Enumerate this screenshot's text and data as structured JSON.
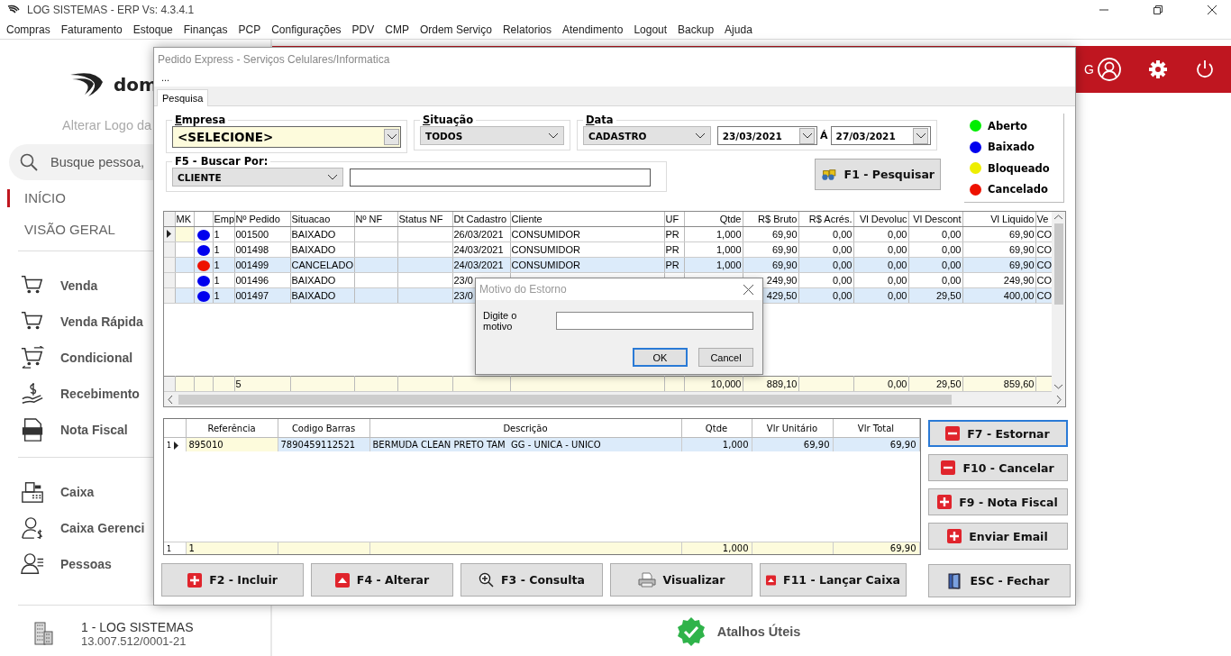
{
  "app": {
    "title": "LOG SISTEMAS - ERP Vs: 4.3.4.1",
    "menu": [
      "Compras",
      "Faturamento",
      "Estoque",
      "Finanças",
      "PCP",
      "Configurações",
      "PDV",
      "CMP",
      "Ordem Serviço",
      "Relatorios",
      "Atendimento",
      "Logout",
      "Backup",
      "Ajuda"
    ]
  },
  "sidebar": {
    "logo_text": "dom",
    "logo_caption": "Alterar Logo da",
    "search": {
      "placeholder": "Busque pessoa,"
    },
    "nav": [
      {
        "label": "INÍCIO",
        "selected": true
      },
      {
        "label": "VISÃO GERAL",
        "selected": false
      }
    ],
    "groups": [
      [
        {
          "label": "Venda"
        },
        {
          "label": "Venda Rápida"
        },
        {
          "label": "Condicional"
        },
        {
          "label": "Recebimento"
        },
        {
          "label": "Nota Fiscal"
        }
      ],
      [
        {
          "label": "Caixa"
        },
        {
          "label": "Caixa Gerenci"
        },
        {
          "label": "Pessoas"
        }
      ]
    ],
    "company": {
      "name": "1 - LOG SISTEMAS",
      "cnpj": "13.007.512/0001-21"
    }
  },
  "header": {
    "user_text": "G"
  },
  "shortcuts": {
    "label": "Atalhos Úteis"
  },
  "order_window": {
    "title": "Pedido Express - Serviços Celulares/Informatica",
    "menu": "...",
    "tabs": [
      {
        "label": "Pesquisa",
        "selected": true
      }
    ],
    "filters": {
      "empresa": {
        "label": "Empresa",
        "underline_first": true,
        "value": "<SELECIONE>"
      },
      "situacao": {
        "label": "Situação",
        "underline_first": true,
        "value": "TODOS"
      },
      "data": {
        "label": "Data",
        "underline_first": true,
        "value": "CADASTRO",
        "from": "23/03/2021",
        "separator": "Á",
        "to": "27/03/2021"
      },
      "buscar": {
        "label": "F5 - Buscar Por:",
        "underline_first": false,
        "value": "CLIENTE"
      }
    },
    "search_button": "F1 - Pesquisar",
    "legend": [
      {
        "label": "Aberto",
        "color": "#00ee00"
      },
      {
        "label": "Baixado",
        "color": "#0000ee"
      },
      {
        "label": "Bloqueado",
        "color": "#eeee00"
      },
      {
        "label": "Cancelado",
        "color": "#ee1100"
      }
    ],
    "orders": {
      "columns": [
        {
          "label": "MK",
          "kind": "text"
        },
        {
          "kind": "status"
        },
        {
          "label": "Emp",
          "kind": "text"
        },
        {
          "label": "Nº Pedido",
          "kind": "text"
        },
        {
          "label": "Situacao",
          "kind": "text"
        },
        {
          "label": "Nº NF",
          "kind": "text"
        },
        {
          "label": "Status NF",
          "kind": "text"
        },
        {
          "label": "Dt Cadastro",
          "kind": "text"
        },
        {
          "label": "Cliente",
          "kind": "text"
        },
        {
          "label": "UF",
          "kind": "text"
        },
        {
          "label": "Qtde",
          "kind": "number"
        },
        {
          "label": "R$ Bruto",
          "kind": "number"
        },
        {
          "label": "R$ Acrés.",
          "kind": "number"
        },
        {
          "label": "Vl Devoluc",
          "kind": "number"
        },
        {
          "label": "Vl Descont",
          "kind": "number"
        },
        {
          "label": "Vl Liquido",
          "kind": "number"
        },
        {
          "label": "Ve",
          "kind": "text"
        }
      ],
      "rows": [
        {
          "current": true,
          "selected": false,
          "color": "#0000ee",
          "emp": "1",
          "pedido": "001500",
          "situacao": "BAIXADO",
          "dt_cadastro": "26/03/2021",
          "cliente": "CONSUMIDOR",
          "uf": "PR",
          "qtde": "1,000",
          "bruto": "69,90",
          "acres": "0,00",
          "devoluc": "0,00",
          "descont": "0,00",
          "liquido": "69,90",
          "ve": "CO"
        },
        {
          "current": false,
          "selected": false,
          "color": "#0000ee",
          "emp": "1",
          "pedido": "001498",
          "situacao": "BAIXADO",
          "dt_cadastro": "24/03/2021",
          "cliente": "CONSUMIDOR",
          "uf": "PR",
          "qtde": "1,000",
          "bruto": "69,90",
          "acres": "0,00",
          "devoluc": "0,00",
          "descont": "0,00",
          "liquido": "69,90",
          "ve": "CO"
        },
        {
          "current": false,
          "selected": true,
          "color": "#ee1100",
          "emp": "1",
          "pedido": "001499",
          "situacao": "CANCELADO",
          "dt_cadastro": "24/03/2021",
          "cliente": "CONSUMIDOR",
          "uf": "PR",
          "qtde": "1,000",
          "bruto": "69,90",
          "acres": "0,00",
          "devoluc": "0,00",
          "descont": "0,00",
          "liquido": "69,90",
          "ve": "CO"
        },
        {
          "current": false,
          "selected": false,
          "color": "#0000ee",
          "emp": "1",
          "pedido": "001496",
          "situacao": "BAIXADO",
          "dt_cadastro": "23/0",
          "bruto": "249,90",
          "acres": "0,00",
          "devoluc": "0,00",
          "descont": "0,00",
          "liquido": "249,90",
          "ve": "CO"
        },
        {
          "current": false,
          "selected": true,
          "color": "#0000ee",
          "emp": "1",
          "pedido": "001497",
          "situacao": "BAIXADO",
          "dt_cadastro": "23/0",
          "bruto": "429,50",
          "acres": "0,00",
          "devoluc": "0,00",
          "descont": "29,50",
          "liquido": "400,00",
          "ve": "CO"
        }
      ],
      "totals": {
        "pedido": "5",
        "qtde": "10,000",
        "bruto": "889,10",
        "devoluc": "0,00",
        "descont": "29,50",
        "liquido": "859,60"
      }
    },
    "items": {
      "columns": [
        {
          "label": "Referência",
          "kind": "text"
        },
        {
          "label": "Codigo Barras",
          "kind": "text"
        },
        {
          "label": "Descrição",
          "kind": "text"
        },
        {
          "label": "Qtde",
          "kind": "number"
        },
        {
          "label": "Vlr Unitário",
          "kind": "number"
        },
        {
          "label": "Vlr Total",
          "kind": "number"
        }
      ],
      "rows": [
        {
          "index": "1",
          "current": true,
          "cells": [
            "895010",
            "7890459112521",
            "BERMUDA CLEAN PRETO TAM  GG - UNICA - UNICO",
            "1,000",
            "69,90",
            "69,90"
          ]
        }
      ],
      "totals": {
        "index": "1",
        "referencia": "1",
        "qtde": "1,000",
        "vlr_total": "69,90"
      }
    },
    "side_buttons": [
      {
        "label": "F7 - Estornar",
        "focused": true
      },
      {
        "label": "F10 - Cancelar",
        "focused": false
      },
      {
        "label": "F9 - Nota Fiscal",
        "focused": false
      },
      {
        "label": "Enviar Email",
        "focused": false
      }
    ],
    "close_button": "ESC - Fechar",
    "bottom_buttons": [
      {
        "label": "F2 - Incluir"
      },
      {
        "label": "F4 - Alterar"
      },
      {
        "label": "F3 - Consulta"
      },
      {
        "label": "Visualizar"
      },
      {
        "label": "F11 - Lançar Caixa"
      }
    ]
  },
  "dialog": {
    "title": "Motivo do Estorno",
    "label": "Digite o motivo",
    "buttons": [
      {
        "label": "OK",
        "focused": true
      },
      {
        "label": "Cancel",
        "focused": false
      }
    ]
  }
}
